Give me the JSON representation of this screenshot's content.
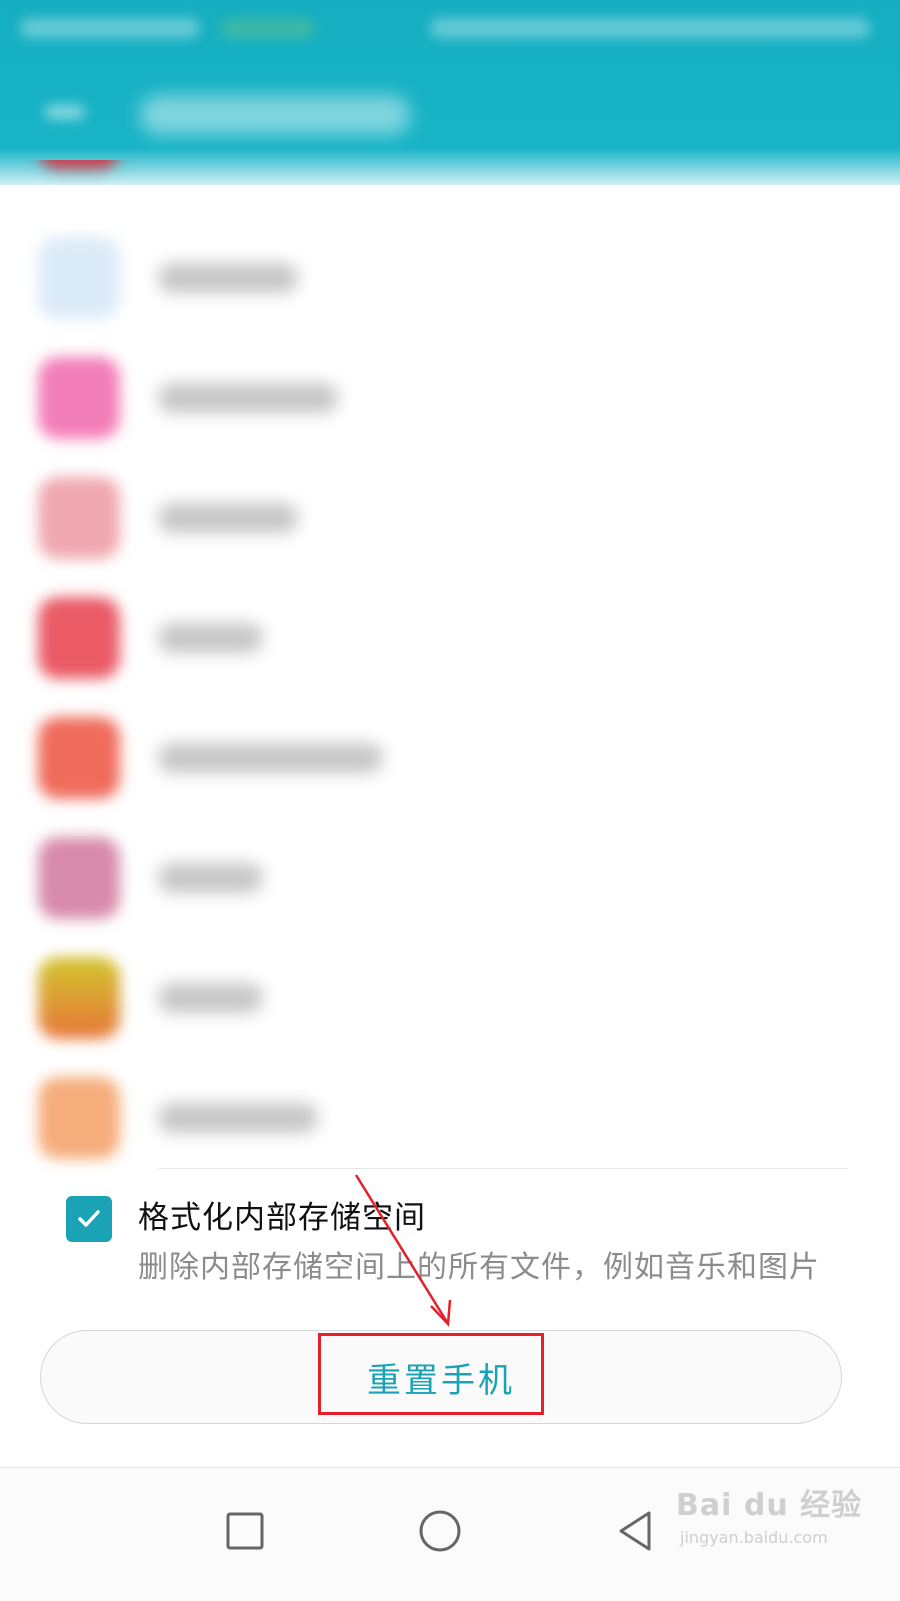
{
  "format_option": {
    "title": "格式化内部存储空间",
    "description": "删除内部存储空间上的所有文件，例如音乐和图片",
    "checked": true
  },
  "reset_button": {
    "label": "重置手机"
  },
  "watermark": {
    "brand": "Bai du 经验",
    "url": "jingyan.baidu.com"
  },
  "nav_bar": {
    "icons": [
      "recent-apps-icon",
      "home-icon",
      "back-icon"
    ]
  },
  "colors": {
    "header": "#18b4c6",
    "accent": "#1aa3b5",
    "annotation": "#e5202c"
  }
}
